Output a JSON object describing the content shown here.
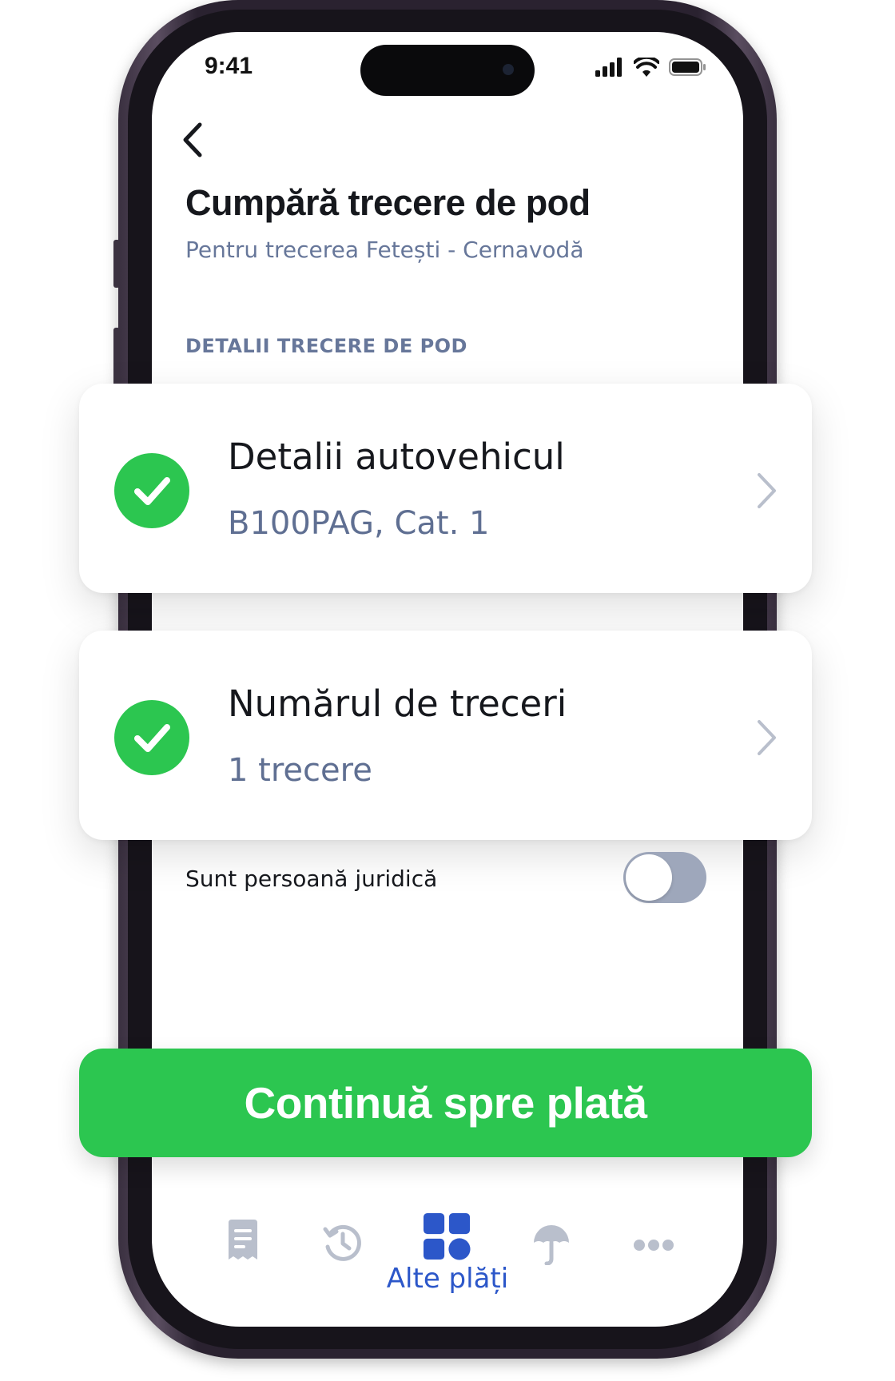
{
  "status_bar": {
    "time": "9:41"
  },
  "header": {
    "title": "Cumpără trecere de pod",
    "subtitle": "Pentru trecerea Fetești - Cernavodă"
  },
  "section": {
    "label": "DETALII TRECERE DE POD"
  },
  "cards": [
    {
      "title": "Detalii autovehicul",
      "value": "B100PAG, Cat. 1",
      "completed": true
    },
    {
      "title": "Numărul de treceri",
      "value": "1 trecere",
      "completed": true
    }
  ],
  "legal_entity_toggle": {
    "label": "Sunt persoană juridică",
    "on": false
  },
  "cta": {
    "label": "Continuă spre plată"
  },
  "tabbar": {
    "items": [
      {
        "icon": "receipt-icon",
        "active": false
      },
      {
        "icon": "history-icon",
        "active": false
      },
      {
        "icon": "grid-icon",
        "label": "Alte plăți",
        "active": true
      },
      {
        "icon": "umbrella-icon",
        "active": false
      },
      {
        "icon": "more-icon",
        "active": false
      }
    ]
  },
  "colors": {
    "accent_green": "#2cc650",
    "active_blue": "#2c57c9",
    "muted_text": "#67779a",
    "inactive_icon": "#b9bfcc"
  }
}
